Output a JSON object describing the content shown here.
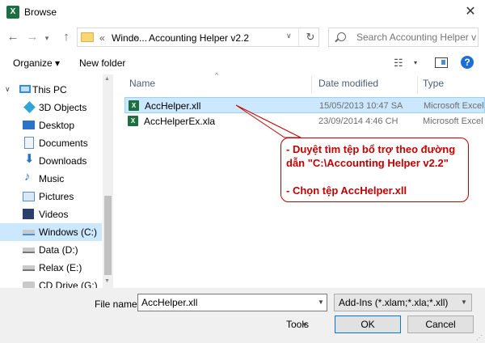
{
  "window": {
    "title": "Browse",
    "app_icon_letter": "X"
  },
  "nav": {
    "back": "←",
    "forward": "→",
    "recent": "▾",
    "up": "↑",
    "breadcrumb": [
      "Windo...",
      "Accounting Helper v2.2"
    ],
    "breadcrumb_prefix": "«",
    "refresh": "↻",
    "search_placeholder": "Search Accounting Helper v..."
  },
  "toolbar": {
    "organize": "Organize ▾",
    "new_folder": "New folder",
    "view_icon": "☷",
    "view_dd": "▾",
    "help": "?"
  },
  "sidebar": {
    "items": [
      {
        "label": "This PC",
        "icon": "pc-icon",
        "color": "#3a8bd8",
        "expanded": true
      },
      {
        "label": "3D Objects",
        "icon": "cube-icon",
        "color": "#2fa4d8"
      },
      {
        "label": "Desktop",
        "icon": "desktop-icon",
        "color": "#2c72c7"
      },
      {
        "label": "Documents",
        "icon": "document-icon",
        "color": "#6b8fb5"
      },
      {
        "label": "Downloads",
        "icon": "download-icon",
        "color": "#2c72c7"
      },
      {
        "label": "Music",
        "icon": "music-icon",
        "color": "#2c72c7"
      },
      {
        "label": "Pictures",
        "icon": "picture-icon",
        "color": "#5b8fc7"
      },
      {
        "label": "Videos",
        "icon": "video-icon",
        "color": "#2c3e6b"
      },
      {
        "label": "Windows (C:)",
        "icon": "drive-icon",
        "color": "#4a90d9",
        "selected": true
      },
      {
        "label": "Data (D:)",
        "icon": "drive-icon",
        "color": "#888888"
      },
      {
        "label": "Relax (E:)",
        "icon": "drive-icon",
        "color": "#888888"
      },
      {
        "label": "CD Drive (G:)",
        "icon": "cd-icon",
        "color": "#888888"
      }
    ]
  },
  "filelist": {
    "columns": [
      "Name",
      "Date modified",
      "Type"
    ],
    "rows": [
      {
        "name": "AccHelper.xll",
        "date": "15/05/2013 10:47 SA",
        "type": "Microsoft Excel",
        "selected": true
      },
      {
        "name": "AccHelperEx.xla",
        "date": "23/09/2014 4:46 CH",
        "type": "Microsoft Excel",
        "selected": false
      }
    ]
  },
  "annotation": {
    "lines": [
      "- Duyệt tìm tệp bổ trợ theo đường",
      "dẫn \"C:\\Accounting Helper v2.2\"",
      "",
      "- Chọn tệp AccHelper.xll"
    ],
    "color": "#c00000"
  },
  "footer": {
    "file_name_label": "File name:",
    "file_name_value": "AccHelper.xll",
    "filter_value": "Add-Ins (*.xlam;*.xla;*.xll)",
    "tools": "Tools",
    "ok": "OK",
    "cancel": "Cancel"
  }
}
